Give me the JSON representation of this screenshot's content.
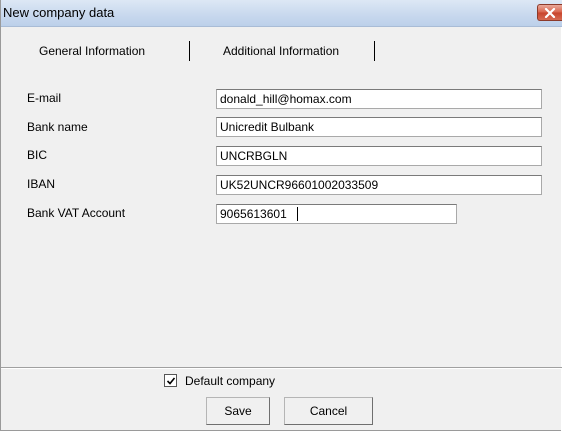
{
  "window": {
    "title": "New company data",
    "close_icon": "close-icon"
  },
  "tabs": [
    {
      "label": "General Information",
      "active": true
    },
    {
      "label": "Additional Information",
      "active": false
    }
  ],
  "form": {
    "fields": [
      {
        "label": "E-mail",
        "value": "donald_hill@homax.com"
      },
      {
        "label": "Bank name",
        "value": "Unicredit Bulbank"
      },
      {
        "label": "BIC",
        "value": "UNCRBGLN"
      },
      {
        "label": "IBAN",
        "value": "UK52UNCR96601002033509"
      },
      {
        "label": "Bank VAT Account",
        "value": "9065613601"
      }
    ]
  },
  "footer": {
    "default_company_label": "Default company",
    "default_company_checked": true,
    "save_label": "Save",
    "cancel_label": "Cancel"
  },
  "colors": {
    "titlebar": "#c9d9ee",
    "close_button": "#d8624a",
    "dialog_bg": "#f0f0f0"
  }
}
